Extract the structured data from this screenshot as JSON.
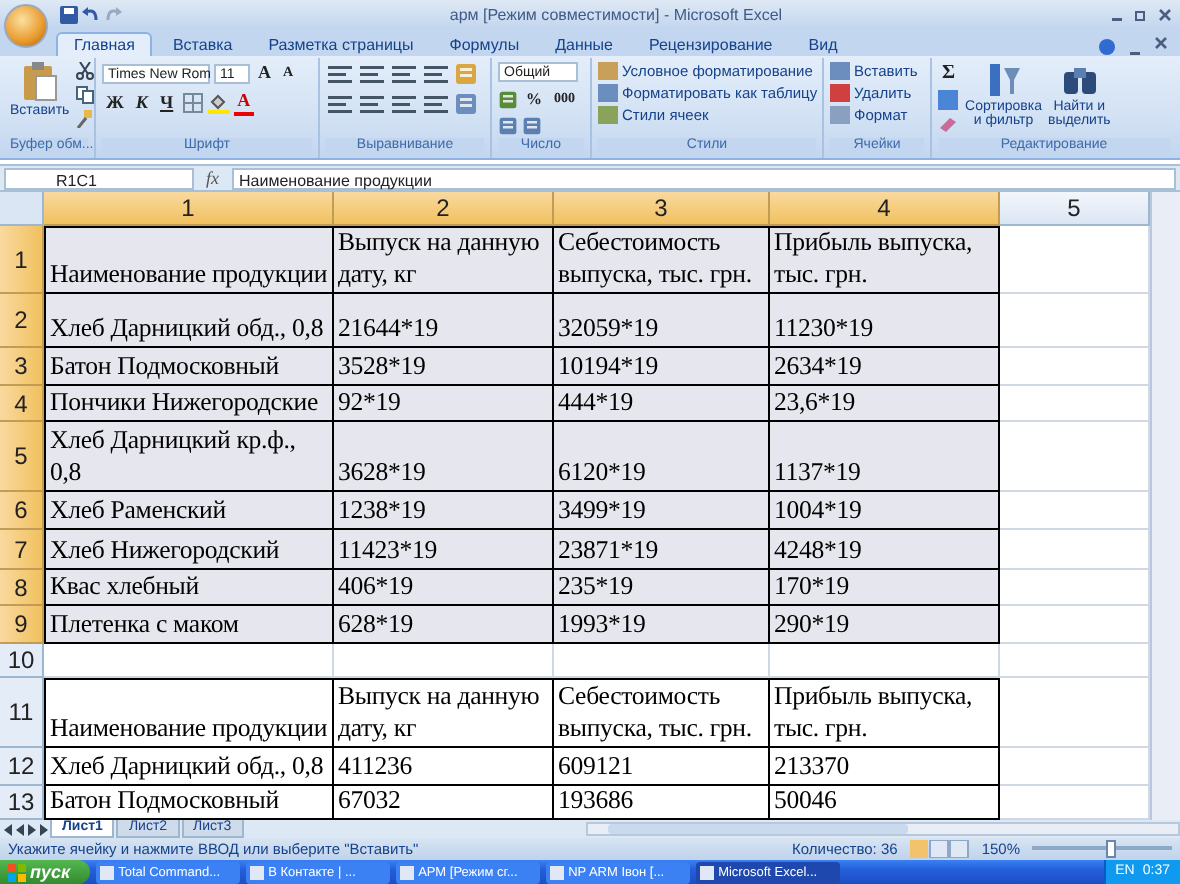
{
  "window": {
    "title": "арм  [Режим совместимости] - Microsoft Excel"
  },
  "tabs": [
    {
      "label": "Главная",
      "selected": true
    },
    {
      "label": "Вставка",
      "selected": false
    },
    {
      "label": "Разметка страницы",
      "selected": false
    },
    {
      "label": "Формулы",
      "selected": false
    },
    {
      "label": "Данные",
      "selected": false
    },
    {
      "label": "Рецензирование",
      "selected": false
    },
    {
      "label": "Вид",
      "selected": false
    }
  ],
  "ribbon": {
    "clipboard": {
      "label": "Буфер обм...",
      "paste": "Вставить"
    },
    "font": {
      "label": "Шрифт",
      "font_name": "Times New Rom",
      "font_size": "11",
      "grow": "A",
      "shrink": "A",
      "bold": "Ж",
      "italic": "К",
      "underline": "Ч",
      "font_color": "A"
    },
    "alignment": {
      "label": "Выравнивание"
    },
    "number": {
      "label": "Число",
      "format": "Общий",
      "percent": "%",
      "thousands": "000"
    },
    "styles": {
      "label": "Стили",
      "items": [
        "Условное форматирование",
        "Форматировать как таблицу",
        "Стили ячеек"
      ]
    },
    "cells": {
      "label": "Ячейки",
      "items": [
        "Вставить",
        "Удалить",
        "Формат"
      ]
    },
    "editing": {
      "label": "Редактирование",
      "sigma": "Σ",
      "sort": [
        "Сортировка",
        "и фильтр"
      ],
      "find": [
        "Найти и",
        "выделить"
      ]
    }
  },
  "formula_bar": {
    "name_box": "R1C1",
    "fx": "fx",
    "value": "Наименование продукции"
  },
  "sheet": {
    "columns": [
      {
        "label": "1",
        "selected": true
      },
      {
        "label": "2",
        "selected": true
      },
      {
        "label": "3",
        "selected": true
      },
      {
        "label": "4",
        "selected": true
      },
      {
        "label": "5",
        "selected": false
      }
    ],
    "rows": [
      {
        "header": "1",
        "selected": true,
        "cells": [
          "Наименование продукции",
          "Выпуск на данную дату, кг",
          "Себестоимость выпуска, тыс. грн.",
          "Прибыль выпуска, тыс. грн."
        ]
      },
      {
        "header": "2",
        "selected": true,
        "cells": [
          "Хлеб Дарницкий обд., 0,8",
          "21644*19",
          "32059*19",
          "11230*19"
        ]
      },
      {
        "header": "3",
        "selected": true,
        "cells": [
          "Батон Подмосковный",
          "3528*19",
          "10194*19",
          "2634*19"
        ]
      },
      {
        "header": "4",
        "selected": true,
        "cells": [
          "Пончики Нижегородские",
          "92*19",
          "444*19",
          "23,6*19"
        ]
      },
      {
        "header": "5",
        "selected": true,
        "cells": [
          "Хлеб Дарницкий кр.ф., 0,8",
          "3628*19",
          "6120*19",
          "1137*19"
        ]
      },
      {
        "header": "6",
        "selected": true,
        "cells": [
          "Хлеб Раменский",
          "1238*19",
          "3499*19",
          "1004*19"
        ]
      },
      {
        "header": "7",
        "selected": true,
        "cells": [
          "Хлеб Нижегородский",
          "11423*19",
          "23871*19",
          "4248*19"
        ]
      },
      {
        "header": "8",
        "selected": true,
        "cells": [
          "Квас хлебный",
          "406*19",
          "235*19",
          "170*19"
        ]
      },
      {
        "header": "9",
        "selected": true,
        "cells": [
          "Плетенка с маком",
          "628*19",
          "1993*19",
          "290*19"
        ]
      },
      {
        "header": "10",
        "selected": false,
        "cells": []
      },
      {
        "header": "11",
        "selected": false,
        "cells": [
          "Наименование продукции",
          "Выпуск на данную дату, кг",
          "Себестоимость выпуска, тыс. грн.",
          "Прибыль выпуска, тыс. грн."
        ]
      },
      {
        "header": "12",
        "selected": false,
        "cells": [
          "Хлеб Дарницкий обд., 0,8",
          "411236",
          "609121",
          "213370"
        ]
      },
      {
        "header": "13",
        "selected": false,
        "cells": [
          "Батон Подмосковный",
          "67032",
          "193686",
          "50046"
        ]
      }
    ]
  },
  "sheet_tabs": [
    {
      "label": "Лист1",
      "selected": true
    },
    {
      "label": "Лист2",
      "selected": false
    },
    {
      "label": "Лист3",
      "selected": false
    }
  ],
  "status_bar": {
    "message": "Укажите ячейку и нажмите ВВОД или выберите \"Вставить\"",
    "count": "Количество: 36",
    "zoom": "150%",
    "zoom_slider": {
      "level": 0.55
    }
  },
  "taskbar": {
    "start": "пуск",
    "items": [
      {
        "label": "Total Command...",
        "selected": false
      },
      {
        "label": "В Контакте | ...",
        "selected": false
      },
      {
        "label": "АРМ [Режим сг...",
        "selected": false
      },
      {
        "label": "NP ARM Івон [...",
        "selected": false
      },
      {
        "label": "Microsoft Excel...",
        "selected": true
      }
    ],
    "language": "EN",
    "clock": "0:37"
  }
}
